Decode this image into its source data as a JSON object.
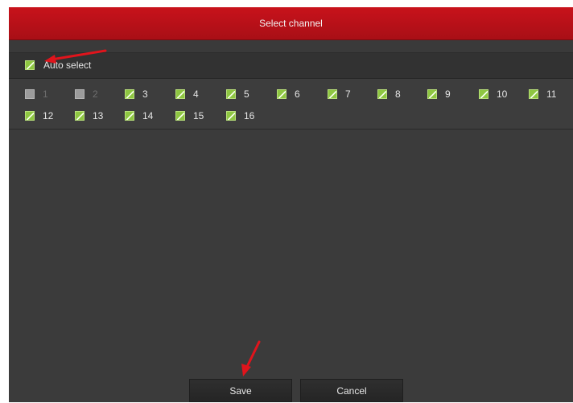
{
  "dialog": {
    "title": "Select channel"
  },
  "auto_select": {
    "label": "Auto select",
    "checked": true
  },
  "channels": [
    {
      "label": "1",
      "checked": false,
      "enabled": false
    },
    {
      "label": "2",
      "checked": false,
      "enabled": false
    },
    {
      "label": "3",
      "checked": true,
      "enabled": true
    },
    {
      "label": "4",
      "checked": true,
      "enabled": true
    },
    {
      "label": "5",
      "checked": true,
      "enabled": true
    },
    {
      "label": "6",
      "checked": true,
      "enabled": true
    },
    {
      "label": "7",
      "checked": true,
      "enabled": true
    },
    {
      "label": "8",
      "checked": true,
      "enabled": true
    },
    {
      "label": "9",
      "checked": true,
      "enabled": true
    },
    {
      "label": "10",
      "checked": true,
      "enabled": true
    },
    {
      "label": "11",
      "checked": true,
      "enabled": true
    },
    {
      "label": "12",
      "checked": true,
      "enabled": true
    },
    {
      "label": "13",
      "checked": true,
      "enabled": true
    },
    {
      "label": "14",
      "checked": true,
      "enabled": true
    },
    {
      "label": "15",
      "checked": true,
      "enabled": true
    },
    {
      "label": "16",
      "checked": true,
      "enabled": true
    }
  ],
  "buttons": {
    "save_label": "Save",
    "cancel_label": "Cancel"
  },
  "colors": {
    "title_bar": "#b8121a",
    "check_green": "#8ec641",
    "annotation_arrow": "#e0141c"
  }
}
